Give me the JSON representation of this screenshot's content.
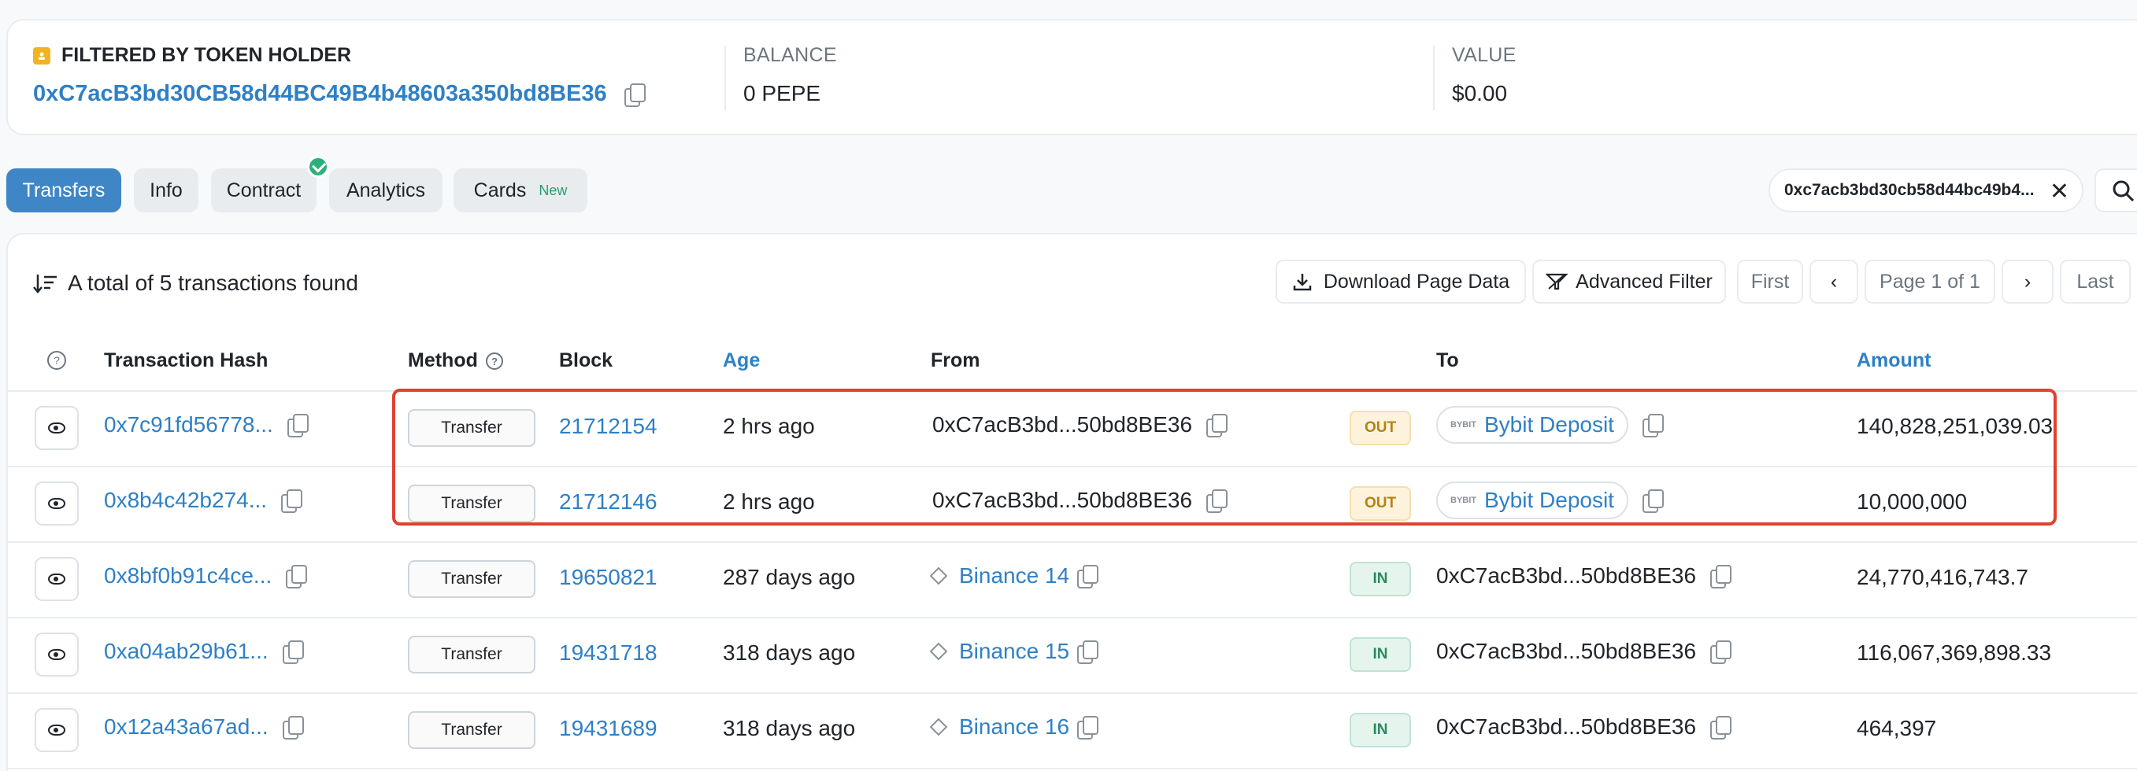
{
  "holder": {
    "title": "FILTERED BY TOKEN HOLDER",
    "address": "0xC7acB3bd30CB58d44BC49B4b48603a350bd8BE36",
    "balance_label": "BALANCE",
    "balance_value": "0 PEPE",
    "value_label": "VALUE",
    "value_value": "$0.00"
  },
  "tabs": [
    {
      "label": "Transfers",
      "active": true
    },
    {
      "label": "Info"
    },
    {
      "label": "Contract"
    },
    {
      "label": "Analytics"
    },
    {
      "label": "Cards",
      "badge": "New"
    }
  ],
  "search": {
    "value": "0xc7acb3bd30cb58d44bc49b4..."
  },
  "summary": "A total of 5 transactions found",
  "toolbar": {
    "download": "Download Page Data",
    "advanced": "Advanced Filter",
    "first": "First",
    "page": "Page 1 of 1",
    "last": "Last"
  },
  "columns": {
    "hash": "Transaction Hash",
    "method": "Method",
    "block": "Block",
    "age": "Age",
    "from": "From",
    "to": "To",
    "amount": "Amount"
  },
  "rows": [
    {
      "hash": "0x7c91fd56778...",
      "method": "Transfer",
      "block": "21712154",
      "age": "2 hrs ago",
      "from": "0xC7acB3bd...50bd8BE36",
      "dir": "OUT",
      "to": "Bybit Deposit",
      "amount": "140,828,251,039.03"
    },
    {
      "hash": "0x8b4c42b274...",
      "method": "Transfer",
      "block": "21712146",
      "age": "2 hrs ago",
      "from": "0xC7acB3bd...50bd8BE36",
      "dir": "OUT",
      "to": "Bybit Deposit",
      "amount": "10,000,000"
    },
    {
      "hash": "0x8bf0b91c4ce...",
      "method": "Transfer",
      "block": "19650821",
      "age": "287 days ago",
      "from": "Binance 14",
      "dir": "IN",
      "to": "0xC7acB3bd...50bd8BE36",
      "amount": "24,770,416,743.7"
    },
    {
      "hash": "0xa04ab29b61...",
      "method": "Transfer",
      "block": "19431718",
      "age": "318 days ago",
      "from": "Binance 15",
      "dir": "IN",
      "to": "0xC7acB3bd...50bd8BE36",
      "amount": "116,067,369,898.33"
    },
    {
      "hash": "0x12a43a67ad...",
      "method": "Transfer",
      "block": "19431689",
      "age": "318 days ago",
      "from": "Binance 16",
      "dir": "IN",
      "to": "0xC7acB3bd...50bd8BE36",
      "amount": "464,397"
    }
  ],
  "bybit_logo_text": "BYBIT"
}
